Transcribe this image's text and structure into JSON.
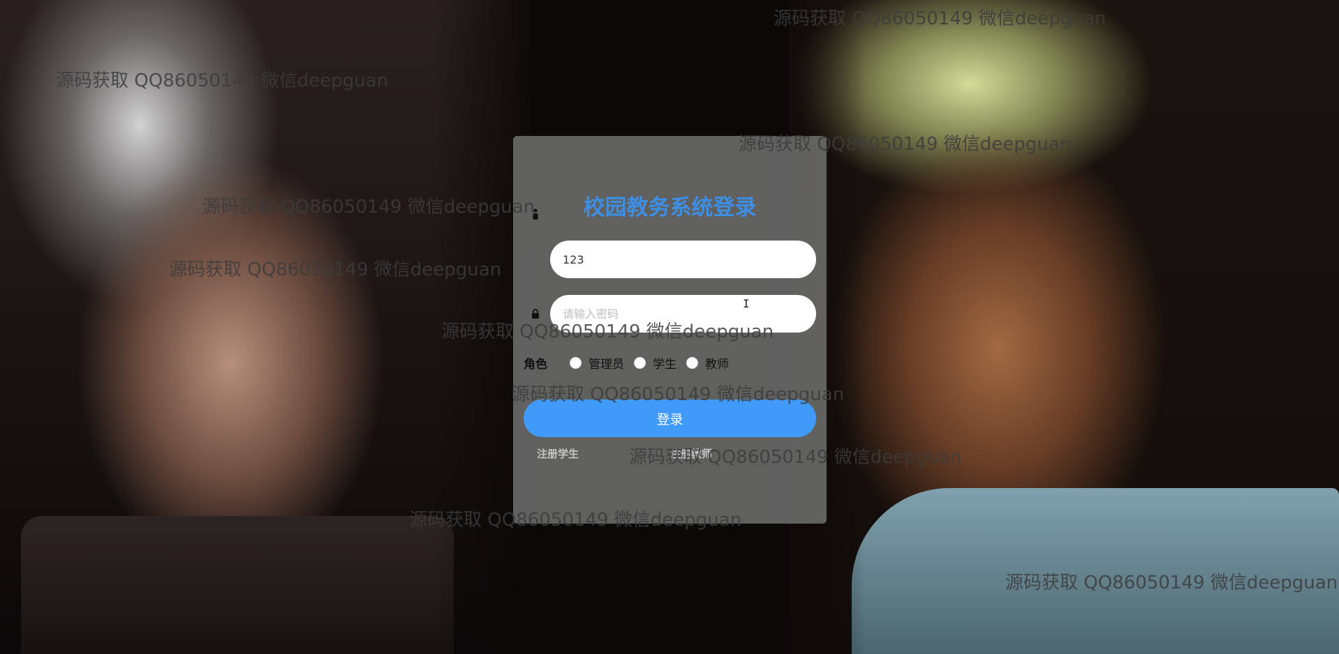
{
  "login": {
    "title": "校园教务系统登录",
    "username_value": "123",
    "password_placeholder": "请输入密码",
    "role_label": "角色",
    "roles": [
      "管理员",
      "学生",
      "教师"
    ],
    "login_button": "登录",
    "register_student": "注册学生",
    "register_teacher": "注册教师"
  },
  "watermarks": [
    "源码获取 QQ86050149 微信deepguan",
    "源码获取 QQ86050149 微信deepguan",
    "源码获取 QQ86050149 微信deepguan",
    "源码获取 QQ86050149 微信deepguan",
    "源码获取 QQ86050149 微信deepguan",
    "源码获取 QQ86050149 微信deepguan",
    "源码获取 QQ86050149 微信deepguan",
    "源码获取 QQ86050149 微信deepguan",
    "源码获取 QQ86050149 微信deepguan",
    "源码获取 QQ86050149 微信deepguan"
  ],
  "colors": {
    "title": "#3d8fe6",
    "button": "#3f9af8",
    "card": "#787a78"
  },
  "icons": {
    "username": "user-icon",
    "password": "lock-icon"
  }
}
